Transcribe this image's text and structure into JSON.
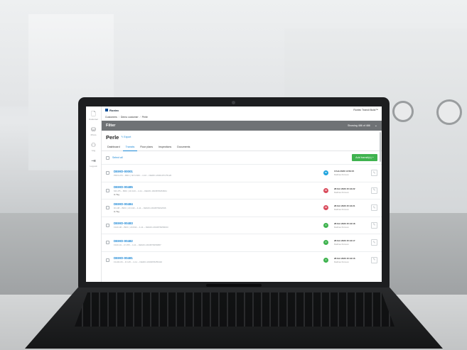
{
  "rail": [
    {
      "icon": "document-icon",
      "glyph": "🗋",
      "label": "Customer"
    },
    {
      "icon": "prism-icon",
      "glyph": "⛁",
      "label": "Prism"
    },
    {
      "icon": "person-icon",
      "glyph": "⚇",
      "label": "Log"
    },
    {
      "icon": "logout-icon",
      "glyph": "⇥",
      "label": "Log out"
    }
  ],
  "brand": {
    "name": "Roxtec"
  },
  "user": "Roxtec Transit Build™",
  "breadcrumb": [
    "Customers",
    "Demo customer",
    "Perle"
  ],
  "filter": {
    "title": "Filter",
    "showing": "Showing 486 of 486",
    "chevron": "⌄"
  },
  "page": {
    "title": "Perle",
    "export": "✎ Export"
  },
  "tabs": [
    "Dashboard",
    "Transits",
    "Floor plans",
    "Inspections",
    "Documents"
  ],
  "active_tab": "Transits",
  "select_all": "Select all",
  "add_button": "Add transit(s) +",
  "rows": [
    {
      "id": "DEMO-00001",
      "desc": "PRO1-P0 – BRC | 60 6-660 – 4-10 – DEMO-1600197175120",
      "tag": "",
      "badge": "50",
      "badge_color": "#1fa4de",
      "date": "3 Feb 2020 14:59:15",
      "by": "Mathias Persson"
    },
    {
      "id": "DEMO-00485",
      "desc": "MO-P5 – BRC | 20 443 – 4-11 – DEMO-1603878263841",
      "tag": "H-Tag",
      "badge": "P2",
      "badge_color": "#d94b5c",
      "date": "28 Oct 2020 15:44:22",
      "by": "Mathias Persson"
    },
    {
      "id": "DEMO-00484",
      "desc": "D3-08 – BRC | 20 443 – 4-11 – DEMO-1603878262636",
      "tag": "H-Tag",
      "badge": "P2",
      "badge_color": "#d94b5c",
      "date": "28 Oct 2020 15:44:21",
      "by": "Mathias Persson"
    },
    {
      "id": "DEMO-00483",
      "desc": "F100-06 – BRC | 20 844 – 4-11 – DEMO-1603878258033",
      "tag": "",
      "badge": "C",
      "badge_color": "#3fb34f",
      "date": "28 Oct 2020 15:44:18",
      "by": "Mathias Persson"
    },
    {
      "id": "DEMO-00482",
      "desc": "F100-01 – R 155 – 4-11 – DEMO-1603878256887",
      "tag": "",
      "badge": "C",
      "badge_color": "#3fb34f",
      "date": "28 Oct 2020 15:44:17",
      "by": "Mathias Persson"
    },
    {
      "id": "DEMO-00481",
      "desc": "F1100-06 – R 125 – 4-11 – DEMO-1603878255432",
      "tag": "",
      "badge": "C",
      "badge_color": "#3fb34f",
      "date": "28 Oct 2020 15:44:16",
      "by": "Mathias Persson"
    }
  ],
  "edit_glyph": "✎",
  "colors": {
    "accent": "#1a87d6",
    "filter_bar": "#6f7275",
    "add_button": "#3fb34f",
    "brand": "#004c97"
  }
}
